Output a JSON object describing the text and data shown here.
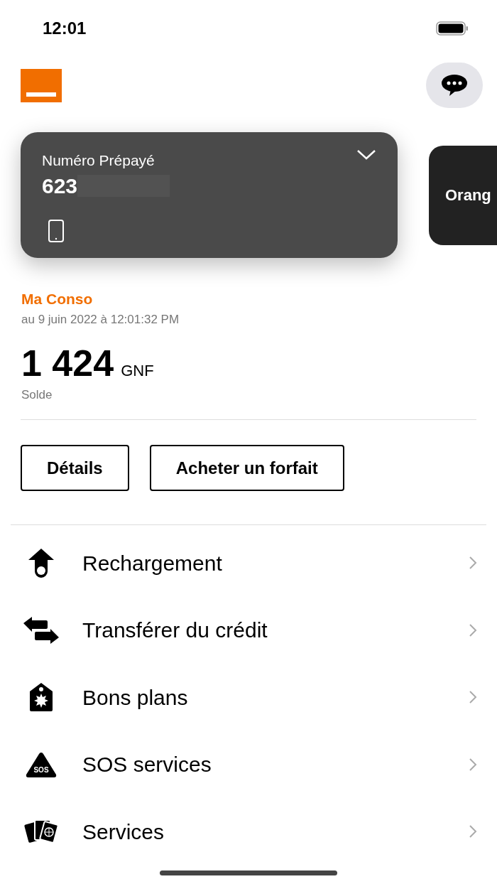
{
  "status_bar": {
    "time": "12:01"
  },
  "account_cards": [
    {
      "label": "Numéro Prépayé",
      "number": "623",
      "selected": true
    },
    {
      "label": "Orang",
      "selected": false
    }
  ],
  "consumption": {
    "title": "Ma Conso",
    "date": "au 9 juin 2022 à 12:01:32 PM",
    "amount": "1 424",
    "currency": "GNF",
    "caption": "Solde"
  },
  "buttons": [
    "Détails",
    "Acheter un forfait"
  ],
  "menu": [
    {
      "kind": "topup",
      "label": "Rechargement"
    },
    {
      "kind": "transfer",
      "label": "Transférer du crédit"
    },
    {
      "kind": "deals",
      "label": "Bons plans"
    },
    {
      "kind": "sos",
      "label": "SOS services",
      "icon_text": "SOS"
    },
    {
      "kind": "services",
      "label": "Services"
    }
  ]
}
